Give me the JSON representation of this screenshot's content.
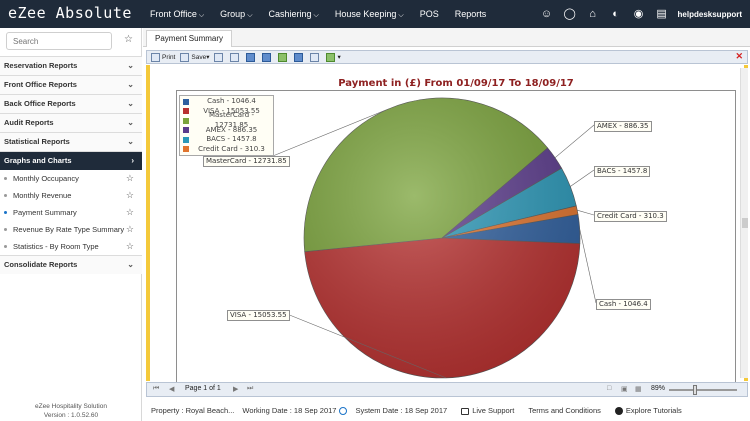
{
  "app": {
    "title": "eZee Absolute",
    "user": "helpdesksupport"
  },
  "nav": {
    "items": [
      {
        "label": "Front Office",
        "dropdown": true
      },
      {
        "label": "Group",
        "dropdown": true
      },
      {
        "label": "Cashiering",
        "dropdown": true
      },
      {
        "label": "House Keeping",
        "dropdown": true
      },
      {
        "label": "POS",
        "dropdown": false
      },
      {
        "label": "Reports",
        "dropdown": false
      }
    ]
  },
  "top_icons": [
    "user-icon",
    "globe-icon",
    "bank-icon",
    "gauge-icon",
    "eye-icon",
    "bed-icon"
  ],
  "sidebar": {
    "search_placeholder": "Search",
    "sections": [
      {
        "label": "Reservation Reports",
        "chev": "⌄"
      },
      {
        "label": "Front Office Reports",
        "chev": "⌄"
      },
      {
        "label": "Back Office Reports",
        "chev": "⌄"
      },
      {
        "label": "Audit Reports",
        "chev": "⌄"
      },
      {
        "label": "Statistical Reports",
        "chev": "⌄"
      },
      {
        "label": "Graphs and Charts",
        "chev": "›",
        "active": true
      },
      {
        "label": "Consolidate Reports",
        "chev": "⌄"
      }
    ],
    "graphs_items": [
      "Monthly Occupancy",
      "Monthly Revenue",
      "Payment Summary",
      "Revenue By Rate Type Summary",
      "Statistics - By Room Type"
    ],
    "current_item": "Payment Summary",
    "brand_line1": "eZee Hospitality Solution",
    "brand_line2": "Version : 1.0.52.60"
  },
  "tab": {
    "label": "Payment Summary"
  },
  "toolbar": {
    "print_label": "Print",
    "save_label": "Save"
  },
  "pager": {
    "page_text": "Page 1 of 1",
    "zoom": "89%"
  },
  "status": {
    "property": "Property : Royal Beach...",
    "working_date": "Working Date : 18 Sep 2017",
    "system_date": "System Date : 18 Sep 2017",
    "live_support": "Live Support",
    "terms": "Terms and Conditions",
    "tutorials": "Explore Tutorials"
  },
  "chart_data": {
    "type": "pie",
    "title": "Payment  in (£) From 01/09/17 To 18/09/17",
    "slices": [
      {
        "name": "Cash",
        "label": "Cash - 1046.4",
        "value": 1046.4,
        "color": "#2f5f9e"
      },
      {
        "name": "VISA",
        "label": "VISA - 15053.55",
        "value": 15053.55,
        "color": "#b8302f"
      },
      {
        "name": "MasterCard",
        "label": "MasterCard - 12731.85",
        "value": 12731.85,
        "color": "#7aa33a"
      },
      {
        "name": "AMEX",
        "label": "AMEX - 886.35",
        "value": 886.35,
        "color": "#5b3b8c"
      },
      {
        "name": "BACS",
        "label": "BACS - 1457.8",
        "value": 1457.8,
        "color": "#2b98b8"
      },
      {
        "name": "Credit Card",
        "label": "Credit Card - 310.3",
        "value": 310.3,
        "color": "#e0742e"
      }
    ],
    "legend_placement": "top-left"
  }
}
